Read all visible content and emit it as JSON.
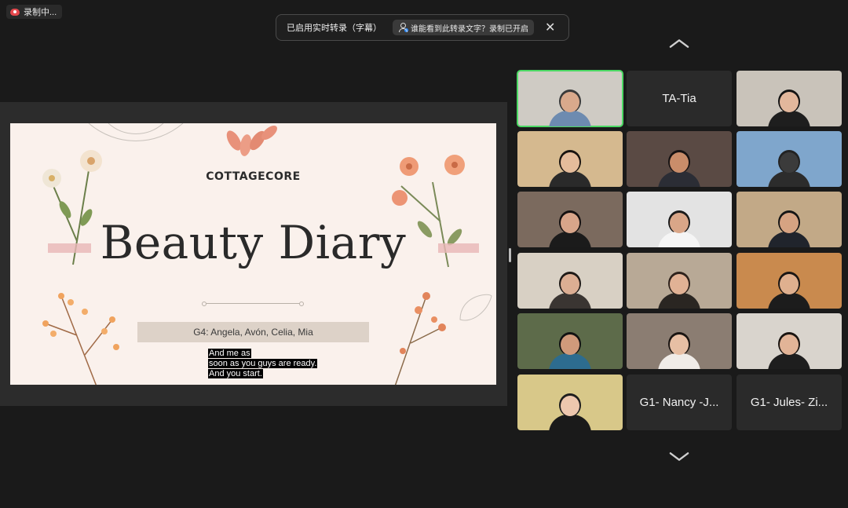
{
  "recording": {
    "label": "录制中..."
  },
  "captions": {
    "enabled_text": "已启用实时转录（字幕）",
    "who_can_see": "谁能看到此转录文字？录制已开启",
    "close_glyph": "✕"
  },
  "slide": {
    "kicker": "COTTAGECORE",
    "title": "Beauty Diary",
    "group": "G4: Angela, Avón, Celia, Mia",
    "subtitle_lines": [
      "And me as",
      "soon as you guys are ready.",
      "And you start."
    ]
  },
  "gallery": {
    "tiles": [
      {
        "name": "",
        "video": true,
        "bg": "#cfcbc4",
        "skin": "#d9a98c",
        "shirt": "#6d8bb0",
        "hair": "#3a3a3a",
        "active": true
      },
      {
        "name": "TA-Tia",
        "video": false
      },
      {
        "name": "",
        "video": true,
        "bg": "#c9c3ba",
        "skin": "#e2b79c",
        "shirt": "#1e1e1e",
        "hair": "#141414"
      },
      {
        "name": "",
        "video": true,
        "bg": "#d5b98f",
        "skin": "#e5bc9b",
        "shirt": "#2a2a2a",
        "hair": "#1a1410"
      },
      {
        "name": "",
        "video": true,
        "bg": "#5a4a44",
        "skin": "#c98d6a",
        "shirt": "#2b2d35",
        "hair": "#171313"
      },
      {
        "name": "",
        "video": true,
        "bg": "#7fa6cc",
        "skin": "#3b3b3b",
        "shirt": "#2c2c2c",
        "hair": "#222"
      },
      {
        "name": "",
        "video": true,
        "bg": "#7b6a5e",
        "skin": "#d8a58a",
        "shirt": "#1b1b1b",
        "hair": "#141010"
      },
      {
        "name": "",
        "video": true,
        "bg": "#e3e3e3",
        "skin": "#d9a688",
        "shirt": "#f5f5f5",
        "hair": "#1a1a1a"
      },
      {
        "name": "",
        "video": true,
        "bg": "#c2a987",
        "skin": "#d6a382",
        "shirt": "#20242c",
        "hair": "#151515"
      },
      {
        "name": "",
        "video": true,
        "bg": "#d8d0c4",
        "skin": "#dcae93",
        "shirt": "#3a3532",
        "hair": "#1f1a17"
      },
      {
        "name": "",
        "video": true,
        "bg": "#b8a996",
        "skin": "#e1b295",
        "shirt": "#2a2622",
        "hair": "#2e221c"
      },
      {
        "name": "",
        "video": true,
        "bg": "#c98a4e",
        "skin": "#dfb08f",
        "shirt": "#1c1c1c",
        "hair": "#1a1614"
      },
      {
        "name": "",
        "video": true,
        "bg": "#5d6b4a",
        "skin": "#d09a7b",
        "shirt": "#2d6c8f",
        "hair": "#121212"
      },
      {
        "name": "",
        "video": true,
        "bg": "#8b7d72",
        "skin": "#e7bfa4",
        "shirt": "#f0ece8",
        "hair": "#1a1512"
      },
      {
        "name": "",
        "video": true,
        "bg": "#d9d4cd",
        "skin": "#e2b497",
        "shirt": "#1e1e1e",
        "hair": "#1a1410"
      },
      {
        "name": "",
        "video": true,
        "bg": "#d8c889",
        "skin": "#edc7ae",
        "shirt": "#1a1a1a",
        "hair": "#1e1e1e"
      },
      {
        "name": "G1- Nancy -J...",
        "video": false
      },
      {
        "name": "G1- Jules- Zi...",
        "video": false
      }
    ]
  }
}
